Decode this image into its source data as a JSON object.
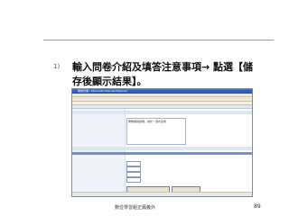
{
  "slide": {
    "bullet_number": "1)",
    "instruction": "輸入問卷介紹及填答注意事項→ 點選【儲存後顯示結果】。",
    "footer": "數位學習組正鳳義外",
    "page_number": "89"
  },
  "screenshot": {
    "window_title": "問卷管理 - Microsoft Internet Explorer",
    "textarea_text": "問卷填寫說明，請於一週內完成"
  },
  "colors": {
    "accent_blue": "#2a5aa8",
    "titlebar_blue": "#1f4fb8",
    "section_blue": "#6f90c8"
  }
}
